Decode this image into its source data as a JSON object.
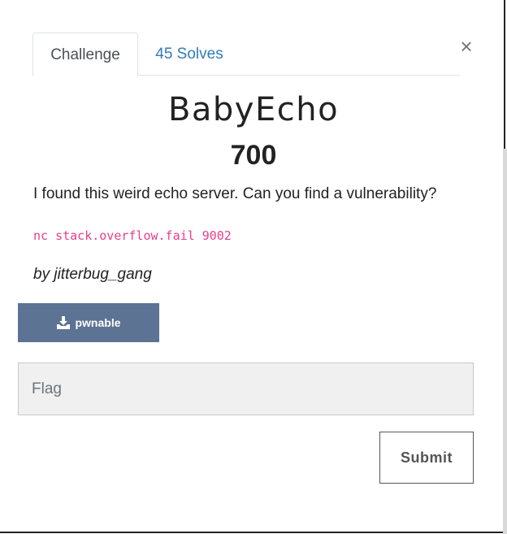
{
  "modal": {
    "close_symbol": "×"
  },
  "tabs": [
    {
      "label": "Challenge",
      "active": true
    },
    {
      "label": "45 Solves",
      "active": false
    }
  ],
  "challenge": {
    "name": "BabyEcho",
    "value": "700",
    "description": "I found this weird echo server. Can you find a vulnerability?",
    "connection": "nc stack.overflow.fail 9002",
    "author": "by jitterbug_gang",
    "file_button": {
      "label": "pwnable",
      "icon": "download-icon"
    }
  },
  "form": {
    "flag_placeholder": "Flag",
    "flag_value": "",
    "submit_label": "Submit"
  },
  "colors": {
    "download_button_bg": "#5c7393",
    "link": "#337ab7",
    "code": "#e83e8c",
    "input_bg": "#f0f0f0"
  }
}
